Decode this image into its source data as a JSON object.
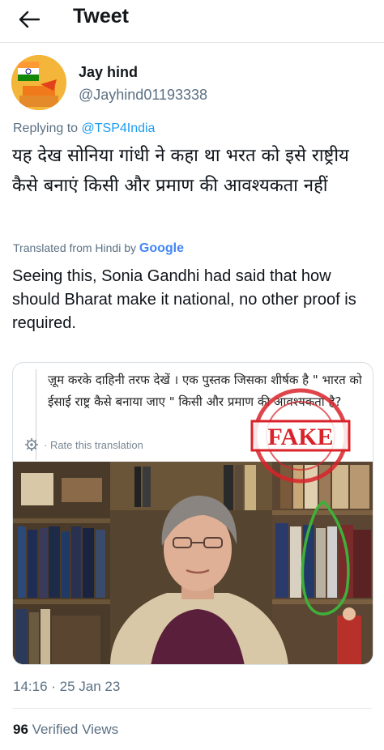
{
  "header": {
    "title": "Tweet"
  },
  "author": {
    "name": "Jay hind",
    "handle": "@Jayhind01193338"
  },
  "reply": {
    "prefix": "Replying to ",
    "mention": "@TSP4India"
  },
  "tweet": {
    "hindi_text": "यह देख सोनिया गांधी ने कहा था भरत को इसे राष्ट्रीय कैसे बनाएं किसी और प्रमाण की आवश्यकता नहीं",
    "translated_prefix": "Translated from Hindi by ",
    "translated_brand": "Google",
    "english_text": "Seeing this, Sonia Gandhi had said that how should Bharat make it national, no other proof is required."
  },
  "media": {
    "inner_hindi_text": "ज़ूम करके दाहिनी तरफ देखें । एक पुस्तक जिसका शीर्षक है \" भारत को ईसाई राष्ट्र कैसे बनाया जाए \" किसी और प्रमाण की आवश्यकता है?",
    "rate_label": "· Rate this translation",
    "stamp_word": "FAKE",
    "stamp_ring_text": "PATENT DATA DETECTED"
  },
  "meta": {
    "timestamp": "14:16 · 25 Jan 23",
    "views_count": "96",
    "views_label": " Verified Views"
  },
  "colors": {
    "accent": "#1d9bf0",
    "secondary_text": "#5b7083",
    "stamp_red": "#d8232a",
    "highlight_green": "#3fb03a"
  }
}
